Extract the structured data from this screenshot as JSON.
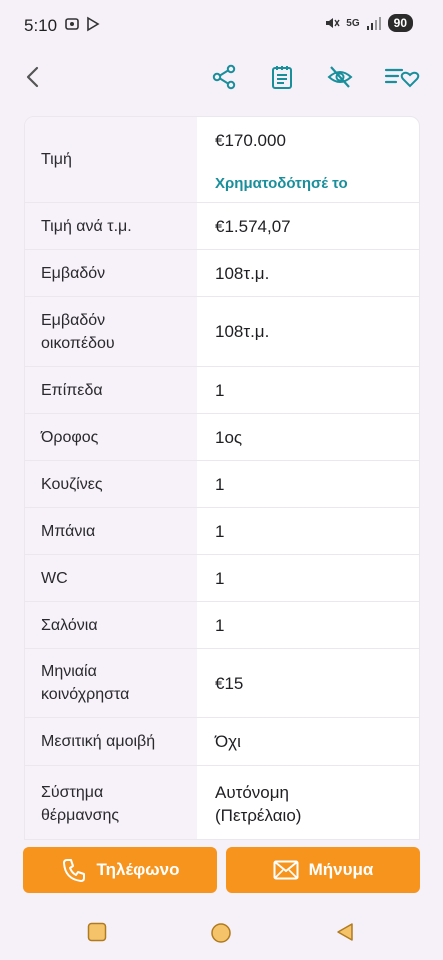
{
  "status": {
    "time": "5:10",
    "battery": "90",
    "network": "5G"
  },
  "toolbar": {
    "icons": [
      "back-icon",
      "share-icon",
      "notes-icon",
      "hide-icon",
      "favorite-list-icon"
    ]
  },
  "details": {
    "price_label": "Τιμή",
    "price_value": "€170.000",
    "financing_link": "Χρηματοδότησέ το",
    "rows": [
      {
        "label": "Τιμή ανά τ.μ.",
        "value": "€1.574,07"
      },
      {
        "label": "Εμβαδόν",
        "value": "108τ.μ."
      },
      {
        "label": "Εμβαδόν οικοπέδου",
        "value": "108τ.μ."
      },
      {
        "label": "Επίπεδα",
        "value": "1"
      },
      {
        "label": "Όροφος",
        "value": "1ος"
      },
      {
        "label": "Κουζίνες",
        "value": "1"
      },
      {
        "label": "Μπάνια",
        "value": "1"
      },
      {
        "label": "WC",
        "value": "1"
      },
      {
        "label": "Σαλόνια",
        "value": "1"
      },
      {
        "label": "Μηνιαία κοινόχρηστα",
        "value": "€15"
      },
      {
        "label": "Μεσιτική αμοιβή",
        "value": "Όχι"
      },
      {
        "label": "Σύστημα θέρμανσης",
        "value": "Αυτόνομη (Πετρέλαιο)"
      }
    ]
  },
  "actions": {
    "phone_label": "Τηλέφωνο",
    "message_label": "Μήνυμα"
  },
  "colors": {
    "accent": "#1a8f9c",
    "primary_button": "#f7941d"
  }
}
